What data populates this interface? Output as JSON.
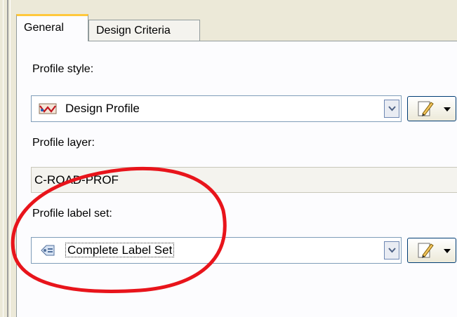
{
  "tabs": {
    "general": "General",
    "design_criteria": "Design Criteria"
  },
  "profile_style": {
    "label": "Profile style:",
    "value": "Design Profile",
    "icon": "profile-style-icon"
  },
  "profile_layer": {
    "label": "Profile layer:",
    "value": "C-ROAD-PROF"
  },
  "profile_label_set": {
    "label": "Profile label set:",
    "value": "Complete Label Set",
    "icon": "label-set-icon"
  },
  "annotation": {
    "color": "#e8141b",
    "shape": "ellipse"
  }
}
